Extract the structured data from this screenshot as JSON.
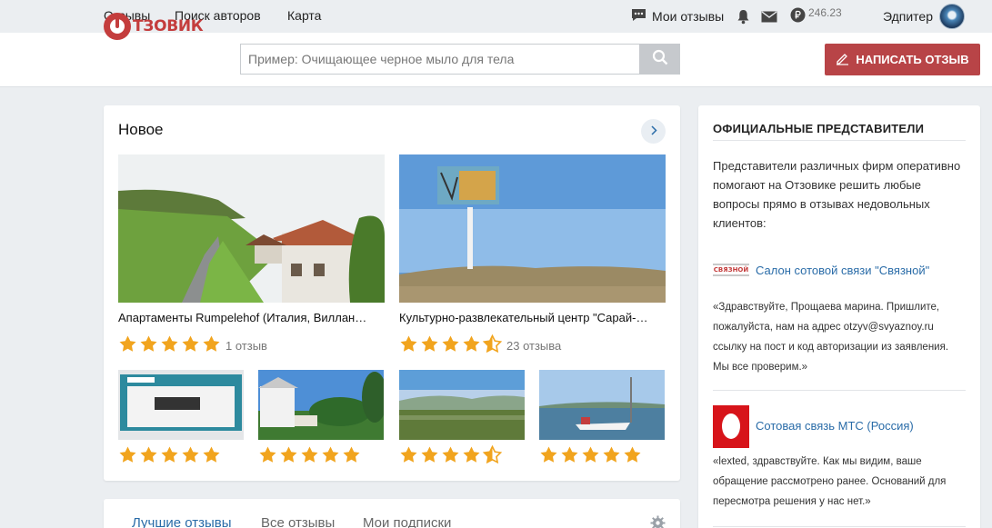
{
  "topbar": {
    "nav": [
      "Отзывы",
      "Поиск авторов",
      "Карта"
    ],
    "my_reviews": "Мои отзывы",
    "balance": "246.23",
    "username": "Эдпитер",
    "icons": [
      "chat-icon",
      "bell-icon",
      "mail-icon",
      "ruble-icon"
    ]
  },
  "header": {
    "logo_text": "ТЗОВИК",
    "search_placeholder": "Пример: Очищающее черное мыло для тела",
    "write_label": "НАПИСАТЬ ОТЗЫВ"
  },
  "colors": {
    "accent": "#b84447",
    "link": "#2a6ca8",
    "star": "#f1a41e"
  },
  "new_section": {
    "title": "Новое",
    "featured": [
      {
        "title": "Апартаменты Rumpelehof (Италия, Виллан…",
        "rating": 5,
        "count": "1 отзыв"
      },
      {
        "title": "Культурно-развлекательный центр \"Сарай-…",
        "rating": 4.5,
        "count": "23 отзыва"
      }
    ],
    "thumbs": [
      {
        "rating": 5
      },
      {
        "rating": 5
      },
      {
        "rating": 4.5
      },
      {
        "rating": 5
      }
    ]
  },
  "tabs": [
    "Лучшие отзывы",
    "Все отзывы",
    "Мои подписки"
  ],
  "sidebar": {
    "title": "ОФИЦИАЛЬНЫЕ ПРЕДСТАВИТЕЛИ",
    "intro": "Представители различных фирм оперативно помогают на Отзовике решить любые вопросы прямо в отзывах недовольных клиентов:",
    "reps": [
      {
        "logo_text": "СВЯЗНОЙ",
        "name": "Салон сотовой связи \"Связной\"",
        "quote": "«Здравствуйте, Прощаева марина. Пришлите, пожалуйста, нам на адрес otzyv@svyaznoy.ru ссылку на пост и код авторизации из заявления. Мы все проверим.»"
      },
      {
        "name": "Сотовая связь МТС (Россия)",
        "quote": "«lexted, здравствуйте. Как мы видим, ваше обращение рассмотрено ранее. Оснований для пересмотра решения у нас нет.»"
      }
    ]
  }
}
